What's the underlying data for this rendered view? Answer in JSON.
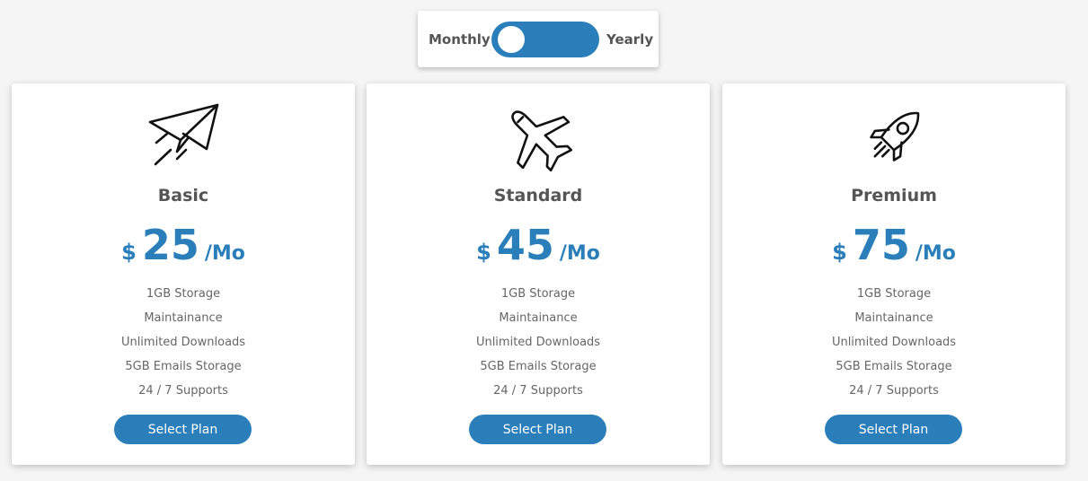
{
  "billing_toggle": {
    "left_label": "Monthly",
    "right_label": "Yearly",
    "selected": "Monthly",
    "color": "#2a7fba"
  },
  "plans": [
    {
      "name": "Basic",
      "icon": "paper-plane-icon",
      "currency": "$",
      "amount": "25",
      "period": "/Mo",
      "features": [
        "1GB Storage",
        "Maintainance",
        "Unlimited Downloads",
        "5GB Emails Storage",
        "24 / 7 Supports"
      ],
      "button_label": "Select Plan"
    },
    {
      "name": "Standard",
      "icon": "airplane-icon",
      "currency": "$",
      "amount": "45",
      "period": "/Mo",
      "features": [
        "1GB Storage",
        "Maintainance",
        "Unlimited Downloads",
        "5GB Emails Storage",
        "24 / 7 Supports"
      ],
      "button_label": "Select Plan"
    },
    {
      "name": "Premium",
      "icon": "rocket-icon",
      "currency": "$",
      "amount": "75",
      "period": "/Mo",
      "features": [
        "1GB Storage",
        "Maintainance",
        "Unlimited Downloads",
        "5GB Emails Storage",
        "24 / 7 Supports"
      ],
      "button_label": "Select Plan"
    }
  ],
  "colors": {
    "accent": "#2a7fba",
    "background": "#f5f5f5",
    "card": "#ffffff",
    "heading_text": "#555555",
    "body_text": "#666666"
  }
}
